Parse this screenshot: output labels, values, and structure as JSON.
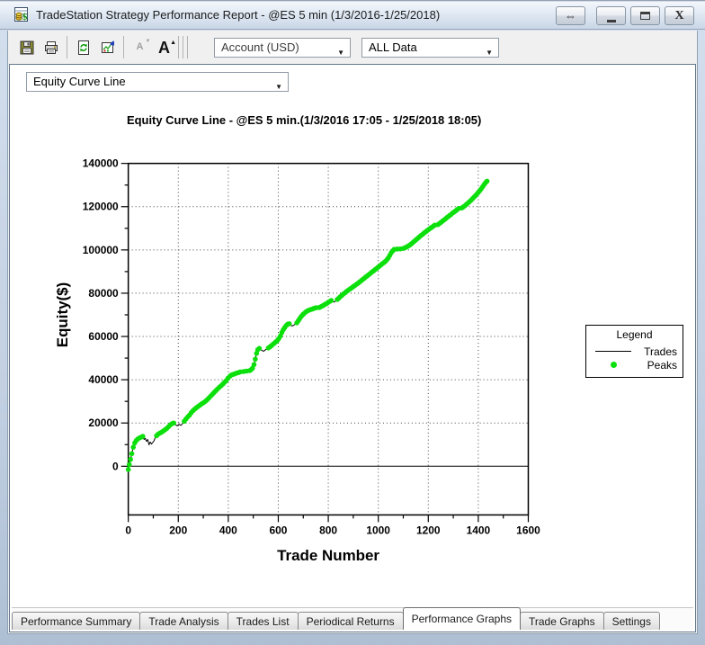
{
  "window": {
    "title": "TradeStation Strategy Performance Report - @ES 5 min (1/3/2016-1/25/2018)",
    "controls": {
      "dock_glyph": "⇔",
      "close_glyph": "X"
    }
  },
  "toolbar": {
    "icons": [
      "save-icon",
      "print-icon",
      "refresh-icon",
      "export-graph-icon",
      "decrease-font-icon",
      "increase-font-icon"
    ],
    "font_small_glyph": "A",
    "font_large_glyph": "A",
    "dropdown_arrow_glyph": "▼",
    "account_dropdown": {
      "value": "Account (USD)"
    },
    "data_range_dropdown": {
      "value": "ALL Data"
    }
  },
  "report": {
    "graph_type_dropdown": {
      "value": "Equity Curve Line"
    }
  },
  "tabs": {
    "items": [
      "Performance Summary",
      "Trade Analysis",
      "Trades List",
      "Periodical Returns",
      "Performance Graphs",
      "Trade Graphs",
      "Settings"
    ],
    "active_index": 4,
    "active_label": "Performance Graphs"
  },
  "colors": {
    "peak_green": "#0CE00C",
    "curve_black": "#000000",
    "grid_dot": "#444444",
    "window_border": "#b9c9dd"
  },
  "chart_data": {
    "type": "line",
    "title": "Equity Curve Line - @ES 5 min.(1/3/2016 17:05 - 1/25/2018 18:05)",
    "xlabel": "Trade Number",
    "ylabel": "Equity($)",
    "xlim": [
      0,
      1600
    ],
    "xticks": [
      0,
      200,
      400,
      600,
      800,
      1000,
      1200,
      1400,
      1600
    ],
    "xminor_step": 100,
    "ylim": [
      0,
      140000
    ],
    "yticks": [
      0,
      20000,
      40000,
      60000,
      80000,
      100000,
      120000,
      140000
    ],
    "yminor_step": 10000,
    "y_axis_floor": -22500,
    "grid": "dotted-major",
    "zero_line": true,
    "legend": {
      "title": "Legend",
      "position": "right",
      "entries": [
        {
          "label": "Trades",
          "type": "line",
          "color": "#000000"
        },
        {
          "label": "Peaks",
          "type": "dot",
          "color": "#0CE00C"
        }
      ]
    },
    "series": [
      {
        "name": "Trades",
        "color": "#000000",
        "points": [
          [
            0,
            -1500
          ],
          [
            4,
            800
          ],
          [
            9,
            3200
          ],
          [
            14,
            5800
          ],
          [
            20,
            8800
          ],
          [
            26,
            10800
          ],
          [
            32,
            11900
          ],
          [
            38,
            12600
          ],
          [
            45,
            13100
          ],
          [
            52,
            13500
          ],
          [
            58,
            13800
          ],
          [
            63,
            12400
          ],
          [
            68,
            12900
          ],
          [
            73,
            11500
          ],
          [
            78,
            12400
          ],
          [
            83,
            9900
          ],
          [
            88,
            11200
          ],
          [
            93,
            10300
          ],
          [
            98,
            11000
          ],
          [
            103,
            11800
          ],
          [
            108,
            13200
          ],
          [
            113,
            14100
          ],
          [
            119,
            14800
          ],
          [
            126,
            15300
          ],
          [
            133,
            15700
          ],
          [
            140,
            16300
          ],
          [
            147,
            16900
          ],
          [
            154,
            17500
          ],
          [
            161,
            18300
          ],
          [
            168,
            19100
          ],
          [
            175,
            19700
          ],
          [
            182,
            20000
          ],
          [
            189,
            19200
          ],
          [
            196,
            18700
          ],
          [
            203,
            19400
          ],
          [
            210,
            18900
          ],
          [
            217,
            19700
          ],
          [
            224,
            20800
          ],
          [
            231,
            21900
          ],
          [
            238,
            22800
          ],
          [
            245,
            23700
          ],
          [
            252,
            24800
          ],
          [
            259,
            25700
          ],
          [
            266,
            26400
          ],
          [
            273,
            27100
          ],
          [
            280,
            27700
          ],
          [
            287,
            28300
          ],
          [
            294,
            28900
          ],
          [
            301,
            29400
          ],
          [
            308,
            30000
          ],
          [
            315,
            30700
          ],
          [
            322,
            31500
          ],
          [
            329,
            32400
          ],
          [
            336,
            33200
          ],
          [
            343,
            34100
          ],
          [
            350,
            34900
          ],
          [
            357,
            35700
          ],
          [
            364,
            36500
          ],
          [
            371,
            37200
          ],
          [
            378,
            38000
          ],
          [
            385,
            38800
          ],
          [
            392,
            39600
          ],
          [
            399,
            40700
          ],
          [
            406,
            41600
          ],
          [
            413,
            42200
          ],
          [
            420,
            42500
          ],
          [
            427,
            42800
          ],
          [
            434,
            43100
          ],
          [
            441,
            43300
          ],
          [
            448,
            43600
          ],
          [
            455,
            43100
          ],
          [
            461,
            43800
          ],
          [
            467,
            43400
          ],
          [
            473,
            44000
          ],
          [
            479,
            43600
          ],
          [
            485,
            44200
          ],
          [
            491,
            44600
          ],
          [
            497,
            45300
          ],
          [
            503,
            47000
          ],
          [
            508,
            49500
          ],
          [
            513,
            52200
          ],
          [
            518,
            53900
          ],
          [
            524,
            54500
          ],
          [
            530,
            54000
          ],
          [
            536,
            53400
          ],
          [
            542,
            53200
          ],
          [
            548,
            53800
          ],
          [
            554,
            54200
          ],
          [
            560,
            54700
          ],
          [
            566,
            55200
          ],
          [
            572,
            55700
          ],
          [
            578,
            56300
          ],
          [
            584,
            56900
          ],
          [
            590,
            57500
          ],
          [
            596,
            58100
          ],
          [
            602,
            59000
          ],
          [
            608,
            60200
          ],
          [
            614,
            61800
          ],
          [
            620,
            63100
          ],
          [
            626,
            64200
          ],
          [
            632,
            65100
          ],
          [
            638,
            65700
          ],
          [
            644,
            65900
          ],
          [
            650,
            65300
          ],
          [
            656,
            64800
          ],
          [
            662,
            65200
          ],
          [
            668,
            65700
          ],
          [
            674,
            66300
          ],
          [
            680,
            67300
          ],
          [
            686,
            68300
          ],
          [
            692,
            69300
          ],
          [
            698,
            70100
          ],
          [
            704,
            70700
          ],
          [
            710,
            71300
          ],
          [
            716,
            71800
          ],
          [
            722,
            72100
          ],
          [
            728,
            72400
          ],
          [
            734,
            72600
          ],
          [
            740,
            72900
          ],
          [
            746,
            73100
          ],
          [
            752,
            73300
          ],
          [
            758,
            72900
          ],
          [
            764,
            73400
          ],
          [
            770,
            73700
          ],
          [
            776,
            74100
          ],
          [
            782,
            74500
          ],
          [
            788,
            74900
          ],
          [
            794,
            75300
          ],
          [
            800,
            75800
          ],
          [
            806,
            76200
          ],
          [
            812,
            76600
          ],
          [
            818,
            76200
          ],
          [
            824,
            75900
          ],
          [
            830,
            76500
          ],
          [
            836,
            77100
          ],
          [
            842,
            77700
          ],
          [
            848,
            78400
          ],
          [
            854,
            79000
          ],
          [
            860,
            79600
          ],
          [
            866,
            80100
          ],
          [
            872,
            80700
          ],
          [
            878,
            81200
          ],
          [
            884,
            81700
          ],
          [
            890,
            82200
          ],
          [
            896,
            82700
          ],
          [
            902,
            83200
          ],
          [
            908,
            83700
          ],
          [
            914,
            84200
          ],
          [
            920,
            84700
          ],
          [
            926,
            85300
          ],
          [
            932,
            85800
          ],
          [
            938,
            86400
          ],
          [
            944,
            86900
          ],
          [
            950,
            87500
          ],
          [
            956,
            88000
          ],
          [
            962,
            88600
          ],
          [
            968,
            89100
          ],
          [
            974,
            89700
          ],
          [
            980,
            90200
          ],
          [
            986,
            90800
          ],
          [
            992,
            91300
          ],
          [
            998,
            91900
          ],
          [
            1004,
            92400
          ],
          [
            1010,
            93000
          ],
          [
            1016,
            93600
          ],
          [
            1022,
            94100
          ],
          [
            1028,
            94700
          ],
          [
            1034,
            95400
          ],
          [
            1040,
            96300
          ],
          [
            1046,
            97500
          ],
          [
            1052,
            98700
          ],
          [
            1058,
            99600
          ],
          [
            1064,
            100300
          ],
          [
            1070,
            100100
          ],
          [
            1076,
            100400
          ],
          [
            1082,
            100200
          ],
          [
            1088,
            100500
          ],
          [
            1094,
            100300
          ],
          [
            1100,
            100700
          ],
          [
            1106,
            101000
          ],
          [
            1112,
            101300
          ],
          [
            1118,
            101700
          ],
          [
            1124,
            102100
          ],
          [
            1130,
            102600
          ],
          [
            1136,
            103200
          ],
          [
            1142,
            103800
          ],
          [
            1148,
            104400
          ],
          [
            1154,
            105000
          ],
          [
            1160,
            105600
          ],
          [
            1166,
            106200
          ],
          [
            1172,
            106800
          ],
          [
            1178,
            107300
          ],
          [
            1184,
            107900
          ],
          [
            1190,
            108400
          ],
          [
            1196,
            109000
          ],
          [
            1202,
            109500
          ],
          [
            1208,
            110000
          ],
          [
            1214,
            110500
          ],
          [
            1220,
            111000
          ],
          [
            1226,
            111500
          ],
          [
            1232,
            111100
          ],
          [
            1238,
            111700
          ],
          [
            1244,
            112200
          ],
          [
            1250,
            112700
          ],
          [
            1256,
            113200
          ],
          [
            1262,
            113800
          ],
          [
            1268,
            114300
          ],
          [
            1274,
            114900
          ],
          [
            1280,
            115400
          ],
          [
            1286,
            116000
          ],
          [
            1292,
            116500
          ],
          [
            1298,
            117100
          ],
          [
            1304,
            117600
          ],
          [
            1310,
            118100
          ],
          [
            1316,
            118700
          ],
          [
            1322,
            119200
          ],
          [
            1328,
            118800
          ],
          [
            1334,
            119400
          ],
          [
            1340,
            119900
          ],
          [
            1346,
            120400
          ],
          [
            1352,
            121000
          ],
          [
            1358,
            121600
          ],
          [
            1364,
            122200
          ],
          [
            1370,
            122900
          ],
          [
            1376,
            123600
          ],
          [
            1382,
            124300
          ],
          [
            1388,
            125000
          ],
          [
            1394,
            125800
          ],
          [
            1400,
            126600
          ],
          [
            1406,
            127400
          ],
          [
            1412,
            128300
          ],
          [
            1418,
            129300
          ],
          [
            1424,
            130300
          ],
          [
            1430,
            131200
          ],
          [
            1435,
            131800
          ]
        ]
      }
    ],
    "peaks_rule": "green dot on every point at a new running equity high"
  }
}
